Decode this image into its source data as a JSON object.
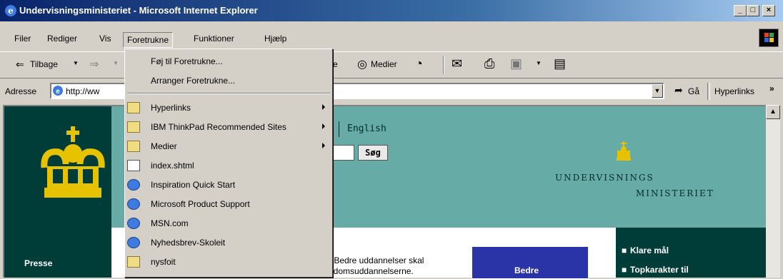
{
  "window": {
    "title": "Undervisningsministeriet - Microsoft Internet Explorer",
    "minimize": "_",
    "restore": "□",
    "close": "×"
  },
  "menu": {
    "file": "Filer",
    "edit": "Rediger",
    "view": "Vis",
    "favorites": "Foretrukne",
    "tools": "Funktioner",
    "help": "Hjælp"
  },
  "toolbar": {
    "back": "Tilbage",
    "media": "Medier",
    "fragment_search": "e"
  },
  "address": {
    "label": "Adresse",
    "value": "http://ww",
    "go": "Gå",
    "links": "Hyperlinks"
  },
  "favorites_menu": {
    "add": "Føj til Foretrukne...",
    "organize": "Arranger Foretrukne...",
    "items": [
      {
        "label": "Hyperlinks",
        "icon": "folder-icon",
        "submenu": true
      },
      {
        "label": "IBM ThinkPad Recommended Sites",
        "icon": "folder-icon",
        "submenu": true
      },
      {
        "label": "Medier",
        "icon": "folder-icon",
        "submenu": true
      },
      {
        "label": "index.shtml",
        "icon": "document-icon",
        "submenu": false
      },
      {
        "label": "Inspiration Quick Start",
        "icon": "ie-page-icon",
        "submenu": false
      },
      {
        "label": "Microsoft Product Support",
        "icon": "ie-page-icon",
        "submenu": false
      },
      {
        "label": "MSN.com",
        "icon": "ie-page-icon",
        "submenu": false
      },
      {
        "label": "Nyhedsbrev-Skoleit",
        "icon": "ie-page-icon",
        "submenu": false
      },
      {
        "label": "nysfoit",
        "icon": "folder-icon",
        "submenu": false
      }
    ]
  },
  "page": {
    "english": "English",
    "search_button": "Søg",
    "brand_line1": "UNDERVISNINGS",
    "brand_line2": "MINISTERIET",
    "presse": "Presse",
    "body_line1": "r Bedre uddannelser skal",
    "body_line2": "ddomsuddannelserne.",
    "bedre": "Bedre",
    "right_links": [
      "Klare mål",
      "Topkarakter til"
    ]
  },
  "colors": {
    "titlebar_start": "#0a246a",
    "content_teal": "#67aba6",
    "dark_green": "#003d38"
  }
}
